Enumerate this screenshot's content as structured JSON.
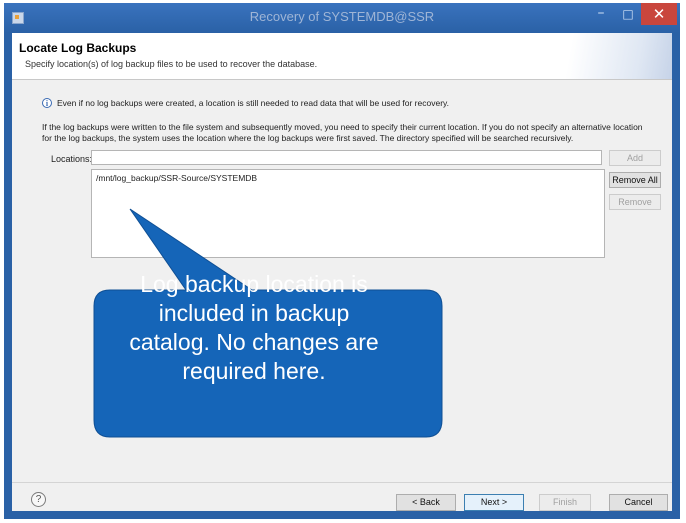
{
  "window": {
    "title": "Recovery of SYSTEMDB@SSR",
    "controls": {
      "minimize": "–",
      "maximize": "□",
      "close": "✕"
    },
    "title_color": "#2a61a6"
  },
  "header": {
    "title": "Locate Log Backups",
    "description": "Specify location(s) of log backup files to be used to recover the database."
  },
  "info": {
    "icon": "info-icon",
    "icon_glyph": "i",
    "text": "Even if no log backups were created, a location is still needed to read data that will be used for recovery."
  },
  "paragraph": "If the log backups were written to the file system and subsequently moved, you need to specify their current location. If you do not specify an alternative location for the log backups, the system uses the location where the log backups were first saved. The directory specified will be searched recursively.",
  "locations": {
    "label": "Locations:",
    "input_value": "",
    "items": [
      "/mnt/log_backup/SSR-Source/SYSTEMDB"
    ],
    "buttons": {
      "add": "Add",
      "remove_all": "Remove All",
      "remove": "Remove"
    }
  },
  "callout": {
    "text": "Log backup location is\nincluded in backup\ncatalog. No changes are\nrequired here.",
    "color": "#1565b8"
  },
  "footer": {
    "help_glyph": "?",
    "back": "< Back",
    "next": "Next >",
    "finish": "Finish",
    "cancel": "Cancel"
  }
}
